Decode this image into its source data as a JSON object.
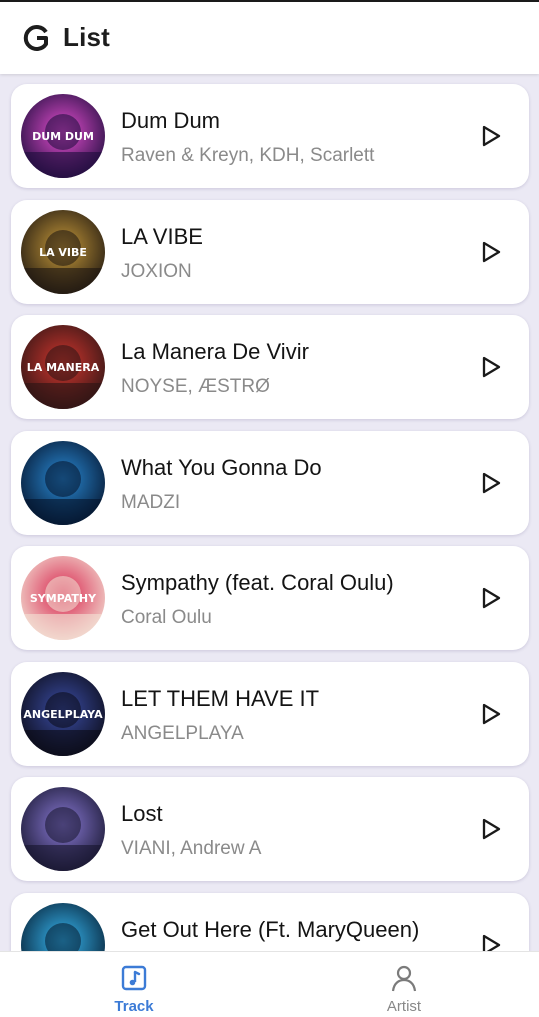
{
  "app": {
    "title": "List"
  },
  "tracks": [
    {
      "title": "Dum Dum",
      "artist": "Raven & Kreyn, KDH, Scarlett",
      "art_colors": [
        "#1a0b3a",
        "#e64fd1"
      ],
      "art_text": "DUM DUM"
    },
    {
      "title": "LA VIBE",
      "artist": "JOXION",
      "art_colors": [
        "#1b1410",
        "#c79a3a"
      ],
      "art_text": "LA VIBE"
    },
    {
      "title": "La Manera De Vivir",
      "artist": "NOYSE, ÆSTRØ",
      "art_colors": [
        "#2a1414",
        "#d2362e"
      ],
      "art_text": "LA MANERA"
    },
    {
      "title": "What You Gonna Do",
      "artist": "MADZI",
      "art_colors": [
        "#04122a",
        "#2a8bd6"
      ],
      "art_text": ""
    },
    {
      "title": "Sympathy (feat. Coral Oulu)",
      "artist": "Coral Oulu",
      "art_colors": [
        "#f3e3d6",
        "#d8244d"
      ],
      "art_text": "SYMPATHY"
    },
    {
      "title": "LET THEM HAVE IT",
      "artist": "ANGELPLAYA",
      "art_colors": [
        "#0a0a14",
        "#3b4da6"
      ],
      "art_text": "ANGELPLAYA"
    },
    {
      "title": "Lost",
      "artist": "VIANI, Andrew A",
      "art_colors": [
        "#15142c",
        "#8a7ad6"
      ],
      "art_text": ""
    },
    {
      "title": "Get Out Here (Ft. MaryQueen)",
      "artist": "",
      "art_colors": [
        "#041a2e",
        "#38b8f2"
      ],
      "art_text": ""
    }
  ],
  "nav": {
    "items": [
      {
        "label": "Track",
        "icon": "music-note-icon",
        "active": true
      },
      {
        "label": "Artist",
        "icon": "person-icon",
        "active": false
      }
    ],
    "active_color": "#3c7bd6",
    "inactive_color": "#888888"
  }
}
